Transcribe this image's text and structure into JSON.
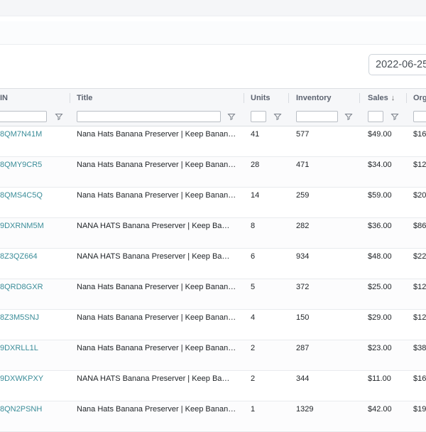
{
  "date_filter": {
    "value": "2022-06-25"
  },
  "table": {
    "columns": {
      "asin": "IN",
      "title": "Title",
      "units": "Units",
      "inventory": "Inventory",
      "sales": "Sales",
      "sales_sort": "↓",
      "org": "Org"
    },
    "rows": [
      {
        "asin": "8QM7N41M",
        "title": "Nana Hats Banana Preserver | Keep Bananas Fresh Longer",
        "units": "41",
        "inventory": "577",
        "sales": "$49.00",
        "org": "$16"
      },
      {
        "asin": "8QMY9CR5",
        "title": "Nana Hats Banana Preserver | Keep Bananas Fresh Longer",
        "units": "28",
        "inventory": "471",
        "sales": "$34.00",
        "org": "$12"
      },
      {
        "asin": "8QMS4C5Q",
        "title": "Nana Hats Banana Preserver | Keep Bananas Fresh Longer",
        "units": "14",
        "inventory": "259",
        "sales": "$59.00",
        "org": "$20"
      },
      {
        "asin": "9DXRNM5M",
        "title": "NANA HATS Banana Preserver | Keep Bananas Fresh Longer",
        "units": "8",
        "inventory": "282",
        "sales": "$36.00",
        "org": "$86"
      },
      {
        "asin": "8Z3QZ664",
        "title": "NANA HATS Banana Preserver | Keep Bananas Fresh Longer",
        "units": "6",
        "inventory": "934",
        "sales": "$48.00",
        "org": "$22"
      },
      {
        "asin": "8QRD8GXR",
        "title": "Nana Hats Banana Preserver | Keep Bananas Fresh Longer",
        "units": "5",
        "inventory": "372",
        "sales": "$25.00",
        "org": "$12"
      },
      {
        "asin": "8Z3M5SNJ",
        "title": "Nana Hats Banana Preserver | Keep Bananas Fresh Longer",
        "units": "4",
        "inventory": "150",
        "sales": "$29.00",
        "org": "$12"
      },
      {
        "asin": "9DXRLL1L",
        "title": "Nana Hats Banana Preserver | Keep Bananas Fresh Longer",
        "units": "2",
        "inventory": "287",
        "sales": "$23.00",
        "org": "$38"
      },
      {
        "asin": "9DXWKPXY",
        "title": "NANA HATS Banana Preserver | Keep Bananas Fresh Longer",
        "units": "2",
        "inventory": "344",
        "sales": "$11.00",
        "org": "$16"
      },
      {
        "asin": "8QN2PSNH",
        "title": "Nana Hats Banana Preserver | Keep Bananas Fresh Longer",
        "units": "1",
        "inventory": "1329",
        "sales": "$42.00",
        "org": "$19"
      }
    ]
  },
  "icons": {
    "filter": "filter-funnel-icon"
  },
  "colors": {
    "link": "#3b8d99",
    "header_bg": "#f6f7f9",
    "border": "#dcdfe3"
  }
}
